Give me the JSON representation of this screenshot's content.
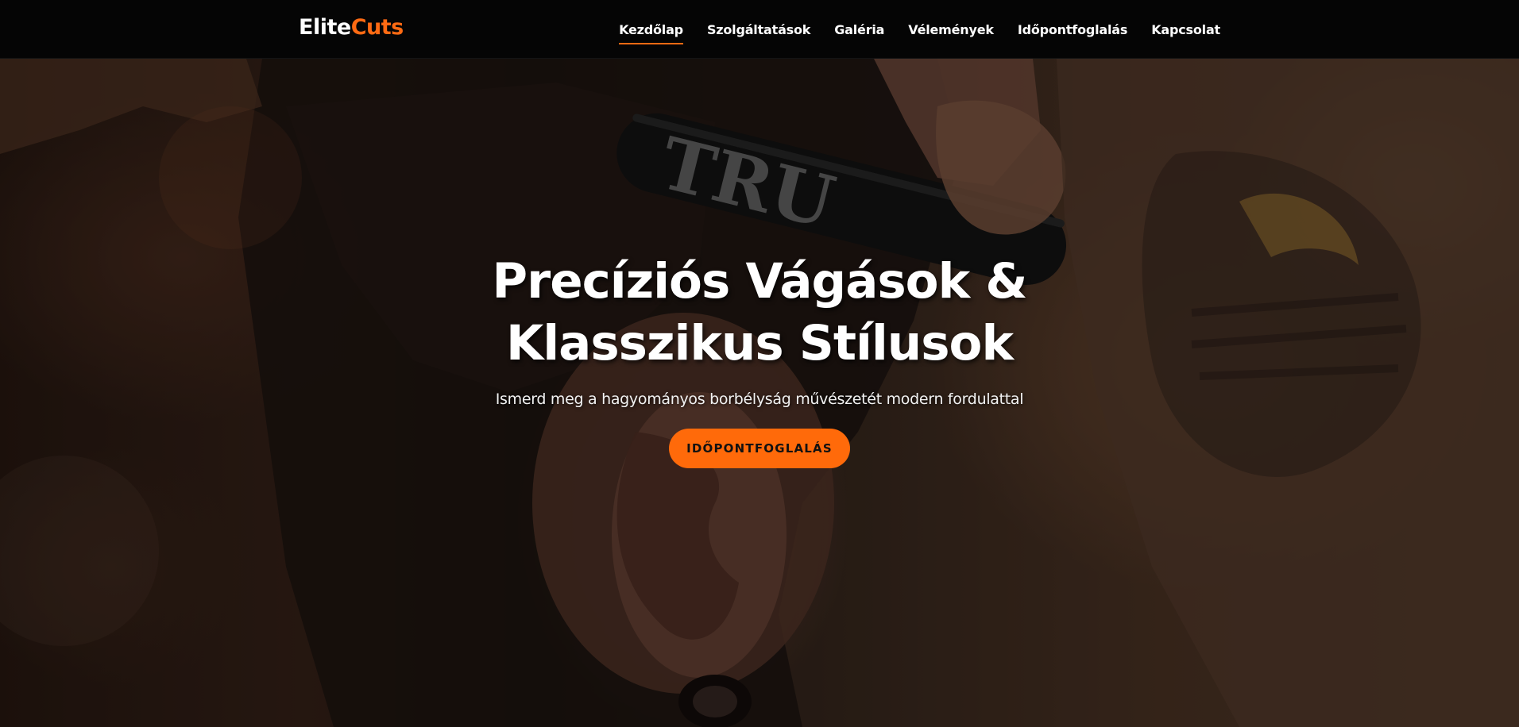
{
  "brand": {
    "name_part1": "Elite",
    "name_part2": "Cuts",
    "accent_color": "#ff6a13"
  },
  "nav": {
    "items": [
      {
        "label": "Kezdőlap",
        "active": true
      },
      {
        "label": "Szolgáltatások",
        "active": false
      },
      {
        "label": "Galéria",
        "active": false
      },
      {
        "label": "Vélemények",
        "active": false
      },
      {
        "label": "Időpontfoglalás",
        "active": false
      },
      {
        "label": "Kapcsolat",
        "active": false
      }
    ]
  },
  "hero": {
    "headline_line1": "Precíziós Vágások &",
    "headline_line2": "Klasszikus Stílusok",
    "subtitle": "Ismerd meg a hagyományos borbélyság művészetét modern fordulattal",
    "cta_label": "IDŐPONTFOGLALÁS",
    "cta_color": "#ff6a0a",
    "background_image": {
      "icon": "barber-razor-photo",
      "razor_text": "TRU"
    }
  }
}
